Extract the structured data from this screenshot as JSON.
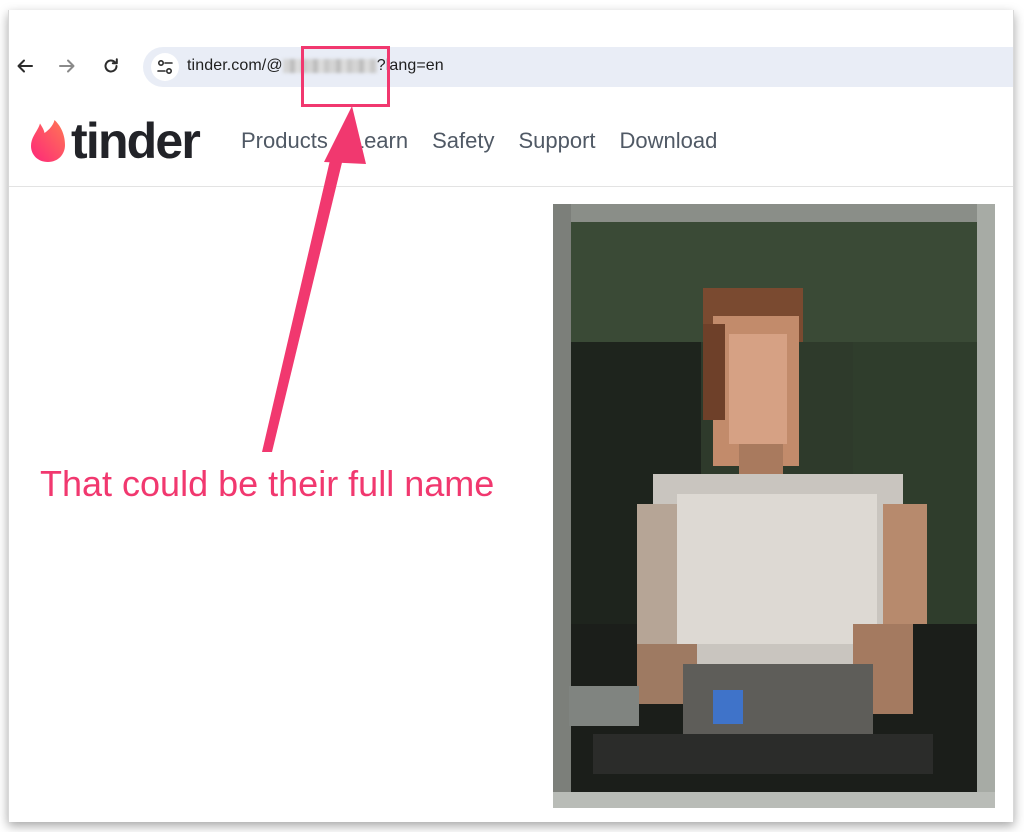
{
  "browser": {
    "url_prefix": "tinder.com/@",
    "url_suffix": "?lang=en"
  },
  "site": {
    "logo_text": "tinder",
    "nav": [
      {
        "label": "Products"
      },
      {
        "label": "Learn"
      },
      {
        "label": "Safety"
      },
      {
        "label": "Support"
      },
      {
        "label": "Download"
      }
    ]
  },
  "annotation": {
    "text": "That could be their full name",
    "color": "#f1386f"
  },
  "colors": {
    "brand_gradient_start": "#fd267a",
    "brand_gradient_end": "#ff7854",
    "omnibox_bg": "#e9edf6",
    "nav_text": "#505965"
  },
  "icons": {
    "back": "arrow-left-icon",
    "forward": "arrow-right-icon",
    "reload": "reload-icon",
    "site_info": "tune-icon",
    "logo": "flame-icon"
  }
}
